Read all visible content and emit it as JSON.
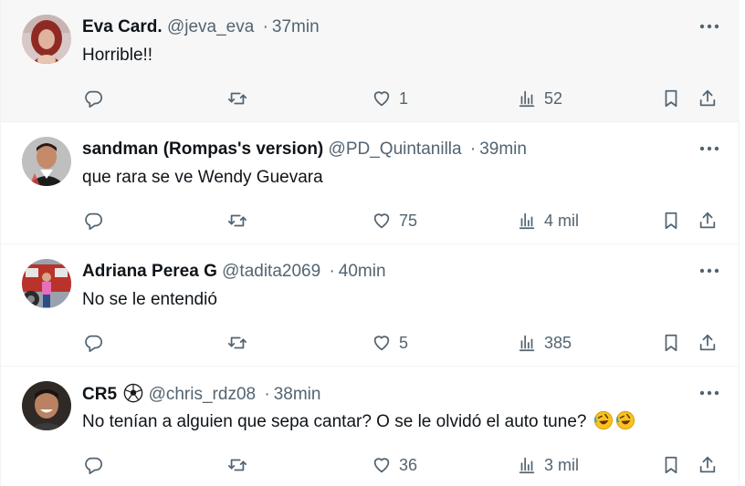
{
  "tweets": [
    {
      "name": "Eva Card.",
      "handle": "@jeva_eva",
      "dot": "·",
      "time": "37min",
      "text": "Horrible!!",
      "likes": "1",
      "views": "52",
      "avatar_icon": "avatar-woman-red-hair"
    },
    {
      "name": "sandman (Rompas's version)",
      "handle": "@PD_Quintanilla",
      "dot": "·",
      "time": "39min",
      "text": "que rara se ve Wendy Guevara",
      "likes": "75",
      "views": "4 mil",
      "avatar_icon": "avatar-man-jersey"
    },
    {
      "name": "Adriana Perea G",
      "handle": "@tadita2069",
      "dot": "·",
      "time": "40min",
      "text": "No se le entendió",
      "likes": "5",
      "views": "385",
      "avatar_icon": "avatar-person-by-truck"
    },
    {
      "name": "CR5",
      "handle": "@chris_rdz08",
      "dot": "·",
      "time": "38min",
      "text": "No tenían a alguien que sepa cantar? O se le  olvidó  el auto tune?",
      "likes": "36",
      "views": "3 mil",
      "avatar_icon": "avatar-man-smiling",
      "name_emoji": "soccer-ball",
      "text_emoji": "rolling-on-floor-laughing"
    }
  ],
  "colors": {
    "text_primary": "#0f1419",
    "text_secondary": "#536471",
    "hover_bg": "#f7f7f7",
    "divider": "#eff3f4"
  }
}
